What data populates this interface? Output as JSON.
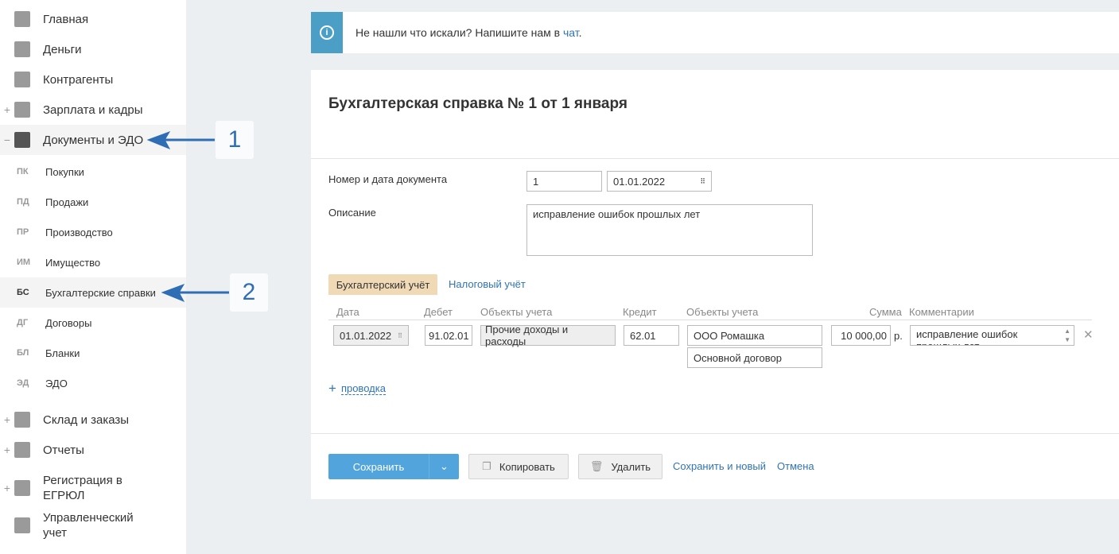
{
  "sidebar": {
    "main_top": [
      {
        "label": "Главная",
        "icon": "home-icon",
        "pm": ""
      },
      {
        "label": "Деньги",
        "icon": "money-icon",
        "pm": ""
      },
      {
        "label": "Контрагенты",
        "icon": "contractor-icon",
        "pm": ""
      },
      {
        "label": "Зарплата и кадры",
        "icon": "wallet-icon",
        "pm": "+"
      },
      {
        "label": "Документы и ЭДО",
        "icon": "folder-icon",
        "pm": "−"
      }
    ],
    "sub": [
      {
        "abbr": "ПК",
        "label": "Покупки"
      },
      {
        "abbr": "ПД",
        "label": "Продажи"
      },
      {
        "abbr": "ПР",
        "label": "Производство"
      },
      {
        "abbr": "ИМ",
        "label": "Имущество"
      },
      {
        "abbr": "БС",
        "label": "Бухгалтерские справки"
      },
      {
        "abbr": "ДГ",
        "label": "Договоры"
      },
      {
        "abbr": "БЛ",
        "label": "Бланки"
      },
      {
        "abbr": "ЭД",
        "label": "ЭДО"
      }
    ],
    "main_bottom": [
      {
        "label": "Склад и заказы",
        "icon": "warehouse-icon",
        "pm": "+"
      },
      {
        "label": "Отчеты",
        "icon": "report-icon",
        "pm": "+"
      },
      {
        "label": "Регистрация в ЕГРЮЛ",
        "icon": "registration-icon",
        "pm": "+"
      },
      {
        "label": "Управленческий учет",
        "icon": "ruble-icon",
        "pm": ""
      }
    ]
  },
  "annotations": [
    "1",
    "2"
  ],
  "banner": {
    "text": "Не нашли что искали? Напишите нам в ",
    "link": "чат",
    "end": "."
  },
  "doc": {
    "title": "Бухгалтерская справка № 1 от 1 января",
    "num_label": "Номер и дата документа",
    "number": "1",
    "date": "01.01.2022",
    "desc_label": "Описание",
    "description": "исправление ошибок прошлых лет",
    "tabs": [
      "Бухгалтерский учёт",
      "Налоговый учёт"
    ],
    "columns": [
      "Дата",
      "Дебет",
      "Объекты учета",
      "Кредит",
      "Объекты учета",
      "Сумма",
      "Комментарии"
    ],
    "row": {
      "date": "01.01.2022",
      "debit": "91.02.01",
      "debit_obj": "Прочие доходы и расходы",
      "credit": "62.01",
      "credit_obj1": "ООО Ромашка",
      "credit_obj2": "Основной договор",
      "sum": "10 000,00",
      "currency": "р.",
      "comment": "исправление ошибок прошлых лет"
    },
    "add_entry": "проводка"
  },
  "actions": {
    "save": "Сохранить",
    "copy": "Копировать",
    "delete": "Удалить",
    "save_new": "Сохранить и новый",
    "cancel": "Отмена"
  }
}
